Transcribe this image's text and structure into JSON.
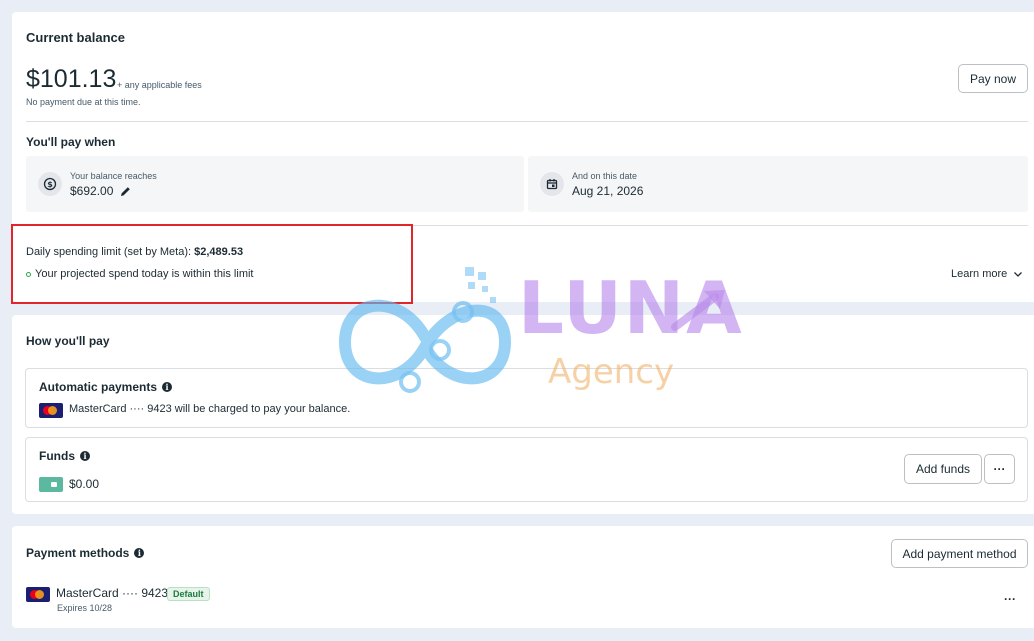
{
  "balance": {
    "title": "Current balance",
    "amount": "$101.13",
    "fees_note": "+ any applicable fees",
    "due_note": "No payment due at this time.",
    "pay_now_label": "Pay now"
  },
  "pay_when": {
    "title": "You'll pay when",
    "threshold_label": "Your balance reaches",
    "threshold_value": "$692.00",
    "date_label": "And on this date",
    "date_value": "Aug 21, 2026"
  },
  "spending_limit": {
    "label": "Daily spending limit (set by Meta):",
    "value": "$2,489.53",
    "status": "Your projected spend today is within this limit",
    "learn_more_label": "Learn more"
  },
  "how_you_pay": {
    "title": "How you'll pay",
    "auto": {
      "title": "Automatic payments",
      "card_text": "MasterCard ···· 9423 will be charged to pay your balance."
    },
    "funds": {
      "title": "Funds",
      "amount": "$0.00",
      "add_funds_label": "Add funds",
      "more_label": "···"
    }
  },
  "payment_methods": {
    "title": "Payment methods",
    "add_label": "Add payment method",
    "card_name": "MasterCard ···· 9423",
    "default_badge": "Default",
    "expires": "Expires 10/28",
    "more_label": "···"
  },
  "watermark": {
    "brand": "LUNA",
    "sub": "Agency"
  },
  "colors": {
    "highlight_box": "#e0262b",
    "status_dot": "#31a24c",
    "watermark_blue": "#62b8f0",
    "watermark_purple": "#b07ae8",
    "watermark_orange": "#f2b36b"
  }
}
